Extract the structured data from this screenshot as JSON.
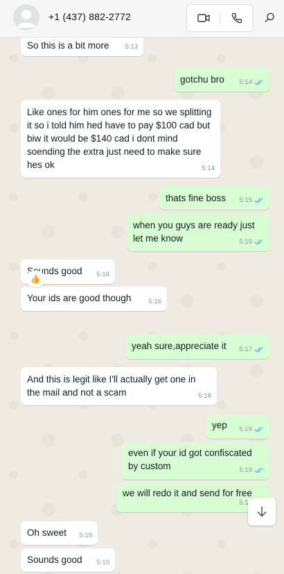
{
  "header": {
    "contact_name": "+1 (437) 882-2772",
    "icons": [
      "avatar-placeholder",
      "video-call-icon",
      "voice-call-icon",
      "search-icon"
    ]
  },
  "messages": [
    {
      "dir": "in",
      "text": "So this is a bit more",
      "time": "5:13"
    },
    {
      "dir": "out",
      "text": "gotchu bro",
      "time": "5:14",
      "status": "read"
    },
    {
      "dir": "in",
      "text": "Like ones for him ones for me so we splitting it so i told him hed have to pay $100 cad but biw it would be $140 cad i dont mind soending the extra just need to make sure hes ok",
      "time": "5:14"
    },
    {
      "dir": "out",
      "text": "thats fine boss",
      "time": "5:15",
      "status": "read"
    },
    {
      "dir": "out",
      "text": "when you guys are ready just let me know",
      "time": "5:15",
      "status": "read"
    },
    {
      "dir": "in",
      "text": "Sounds good",
      "time": "5:16"
    },
    {
      "dir": "in",
      "text": "Your ids are good though",
      "time": "5:16",
      "reaction": "👍"
    },
    {
      "dir": "out",
      "text": "yeah sure,appreciate it",
      "time": "5:17",
      "status": "read"
    },
    {
      "dir": "in",
      "text": "And this is legit like I'll actually get one in the mail and not a scam",
      "time": "5:18"
    },
    {
      "dir": "out",
      "text": "yep",
      "time": "5:19",
      "status": "read"
    },
    {
      "dir": "out",
      "text": "even if your id got confiscated by custom",
      "time": "5:19",
      "status": "read"
    },
    {
      "dir": "out",
      "text": "we will redo it and send for free",
      "time": "5:19",
      "status": "read"
    },
    {
      "dir": "in",
      "text": "Oh sweet",
      "time": "5:19"
    },
    {
      "dir": "in",
      "text": "Sounds good",
      "time": "5:19"
    }
  ],
  "colors": {
    "incoming_bubble": "#ffffff",
    "outgoing_bubble": "#d9fdd3",
    "chat_background": "#efeae2",
    "read_ticks": "#53bdeb"
  }
}
